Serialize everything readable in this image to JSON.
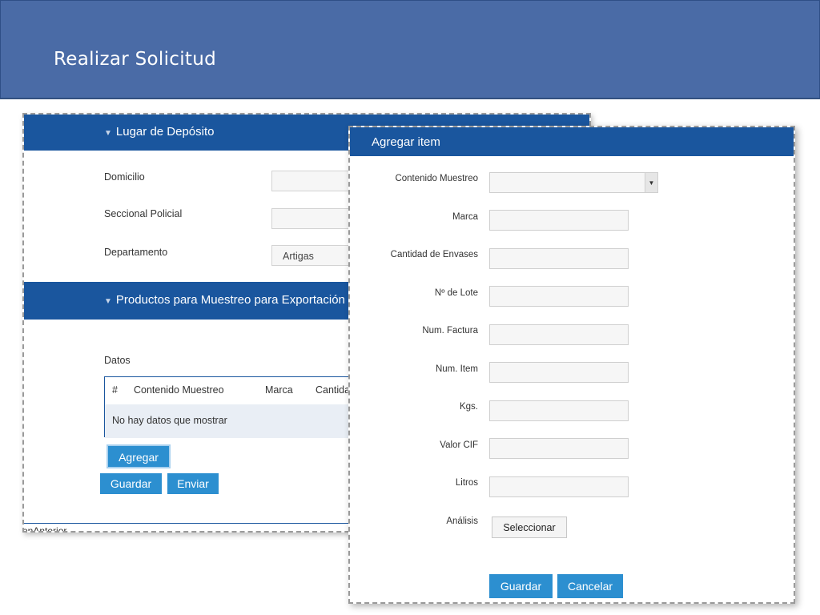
{
  "page": {
    "title": "Realizar Solicitud"
  },
  "main_form": {
    "section_deposito": {
      "title": "Lugar de Depósito",
      "fields": {
        "domicilio_label": "Domicilio",
        "seccional_label": "Seccional Policial",
        "departamento_label": "Departamento",
        "departamento_value": "Artigas"
      }
    },
    "section_productos": {
      "title": "Productos para Muestreo para Exportación",
      "datos_label": "Datos",
      "table": {
        "columns": [
          "#",
          "Contenido Muestreo",
          "Marca",
          "Cantida"
        ],
        "empty_text": "No hay datos que mostrar"
      },
      "add_button": "Agregar"
    },
    "buttons": {
      "guardar": "Guardar",
      "enviar": "Enviar"
    },
    "bottom_link": "onAnterior"
  },
  "modal": {
    "title": "Agregar item",
    "fields": {
      "contenido_muestreo": "Contenido Muestreo",
      "marca": "Marca",
      "cantidad_envases": "Cantidad de Envases",
      "num_lote": "Nº de Lote",
      "num_factura": "Num. Factura",
      "num_item": "Num. Item",
      "kgs": "Kgs.",
      "valor_cif": "Valor CIF",
      "litros": "Litros",
      "analisis": "Análisis"
    },
    "select_button": "Seleccionar",
    "buttons": {
      "guardar": "Guardar",
      "cancelar": "Cancelar"
    }
  },
  "colors": {
    "title_bar": "#4a6ba6",
    "section_header": "#1a569e",
    "primary_button": "#2c8fd0"
  },
  "icons": {
    "section_caret": "caret-down-icon",
    "select_arrow": "dropdown-arrow-icon"
  }
}
